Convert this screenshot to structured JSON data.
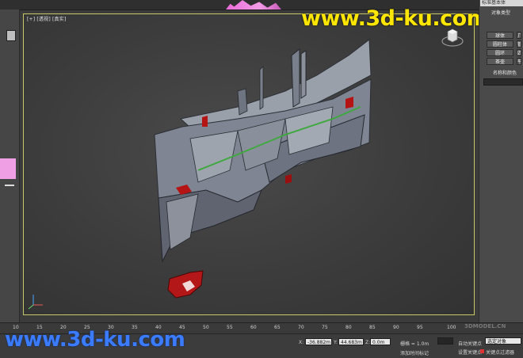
{
  "watermark_top": "www.3d-ku.com",
  "watermark_bottom": "www.3d-ku.com",
  "viewport": {
    "label": "[+] [透视] [真实]"
  },
  "right_panel": {
    "title": "标准基本体",
    "section_object_type": "对象类型",
    "buttons": [
      {
        "label": "球体",
        "side": "几"
      },
      {
        "label": "圆柱体",
        "side": "管"
      },
      {
        "label": "圆环",
        "side": "四"
      },
      {
        "label": "茶壶",
        "side": "平"
      }
    ],
    "section_name_color": "名称和颜色"
  },
  "timeline": {
    "ticks": [
      "10",
      "15",
      "20",
      "25",
      "30",
      "35",
      "40",
      "45",
      "50",
      "55",
      "60",
      "65",
      "70",
      "75",
      "80",
      "85",
      "90",
      "95",
      "100"
    ]
  },
  "status": {
    "x_label": "X:",
    "x_value": "-36.882m",
    "y_label": "Y:",
    "y_value": "44.683m",
    "z_label": "Z:",
    "z_value": "0.0m",
    "grid": "栅格 = 1.0m",
    "add_time_tag": "添加时间标记",
    "auto_key": "自动关键点",
    "selected_objects": "选定对象",
    "set_key": "设置关键点",
    "key_filters": "关键点过滤器",
    "brand": "3DMODEL.CN"
  },
  "colors": {
    "viewport_border": "#c8c864",
    "watermark_yellow": "#ffe600",
    "watermark_blue": "#3b7bff",
    "model_gray": "#8b8f99",
    "model_red": "#b41414",
    "model_green": "#3fa83f"
  }
}
